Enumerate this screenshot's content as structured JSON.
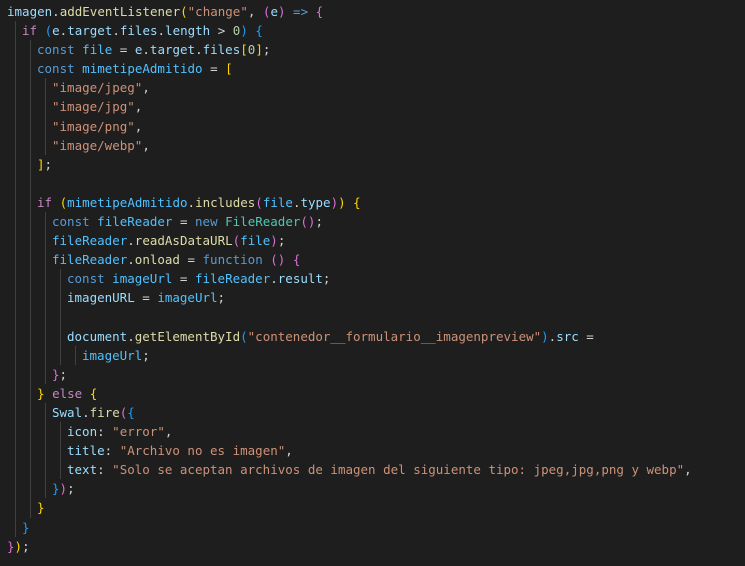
{
  "editor": {
    "lines": [
      [
        [
          "imagen",
          "var"
        ],
        [
          ".",
          "pun"
        ],
        [
          "addEventListener",
          "fn"
        ],
        [
          "(",
          "b1"
        ],
        [
          "\"change\"",
          "str"
        ],
        [
          ", ",
          "pun"
        ],
        [
          "(",
          "b2"
        ],
        [
          "e",
          "var"
        ],
        [
          ")",
          "b2"
        ],
        [
          " => ",
          "kw"
        ],
        [
          "{",
          "b2"
        ]
      ],
      [
        [
          "if",
          "ctl"
        ],
        [
          " ",
          "pun"
        ],
        [
          "(",
          "b3"
        ],
        [
          "e",
          "var"
        ],
        [
          ".",
          "pun"
        ],
        [
          "target",
          "var"
        ],
        [
          ".",
          "pun"
        ],
        [
          "files",
          "var"
        ],
        [
          ".",
          "pun"
        ],
        [
          "length",
          "var"
        ],
        [
          " > ",
          "pun"
        ],
        [
          "0",
          "num"
        ],
        [
          ")",
          "b3"
        ],
        [
          " ",
          "pun"
        ],
        [
          "{",
          "b3"
        ]
      ],
      [
        [
          "const",
          "kw"
        ],
        [
          " ",
          "pun"
        ],
        [
          "file",
          "cst"
        ],
        [
          " = ",
          "pun"
        ],
        [
          "e",
          "var"
        ],
        [
          ".",
          "pun"
        ],
        [
          "target",
          "var"
        ],
        [
          ".",
          "pun"
        ],
        [
          "files",
          "var"
        ],
        [
          "[",
          "b1"
        ],
        [
          "0",
          "num"
        ],
        [
          "]",
          "b1"
        ],
        [
          ";",
          "pun"
        ]
      ],
      [
        [
          "const",
          "kw"
        ],
        [
          " ",
          "pun"
        ],
        [
          "mimetipeAdmitido",
          "cst"
        ],
        [
          " = ",
          "pun"
        ],
        [
          "[",
          "b1"
        ]
      ],
      [
        [
          "\"image/jpeg\"",
          "str"
        ],
        [
          ",",
          "pun"
        ]
      ],
      [
        [
          "\"image/jpg\"",
          "str"
        ],
        [
          ",",
          "pun"
        ]
      ],
      [
        [
          "\"image/png\"",
          "str"
        ],
        [
          ",",
          "pun"
        ]
      ],
      [
        [
          "\"image/webp\"",
          "str"
        ],
        [
          ",",
          "pun"
        ]
      ],
      [
        [
          "]",
          "b1"
        ],
        [
          ";",
          "pun"
        ]
      ],
      [],
      [
        [
          "if",
          "ctl"
        ],
        [
          " ",
          "pun"
        ],
        [
          "(",
          "b1"
        ],
        [
          "mimetipeAdmitido",
          "cst"
        ],
        [
          ".",
          "pun"
        ],
        [
          "includes",
          "fn"
        ],
        [
          "(",
          "b2"
        ],
        [
          "file",
          "cst"
        ],
        [
          ".",
          "pun"
        ],
        [
          "type",
          "var"
        ],
        [
          ")",
          "b2"
        ],
        [
          ")",
          "b1"
        ],
        [
          " ",
          "pun"
        ],
        [
          "{",
          "b1"
        ]
      ],
      [
        [
          "const",
          "kw"
        ],
        [
          " ",
          "pun"
        ],
        [
          "fileReader",
          "cst"
        ],
        [
          " = ",
          "pun"
        ],
        [
          "new",
          "kw"
        ],
        [
          " ",
          "pun"
        ],
        [
          "FileReader",
          "cls"
        ],
        [
          "()",
          "b2"
        ],
        [
          ";",
          "pun"
        ]
      ],
      [
        [
          "fileReader",
          "cst"
        ],
        [
          ".",
          "pun"
        ],
        [
          "readAsDataURL",
          "fn"
        ],
        [
          "(",
          "b2"
        ],
        [
          "file",
          "cst"
        ],
        [
          ")",
          "b2"
        ],
        [
          ";",
          "pun"
        ]
      ],
      [
        [
          "fileReader",
          "cst"
        ],
        [
          ".",
          "pun"
        ],
        [
          "onload",
          "fn"
        ],
        [
          " = ",
          "pun"
        ],
        [
          "function",
          "kw"
        ],
        [
          " ",
          "pun"
        ],
        [
          "()",
          "b2"
        ],
        [
          " ",
          "pun"
        ],
        [
          "{",
          "b2"
        ]
      ],
      [
        [
          "const",
          "kw"
        ],
        [
          " ",
          "pun"
        ],
        [
          "imageUrl",
          "cst"
        ],
        [
          " = ",
          "pun"
        ],
        [
          "fileReader",
          "cst"
        ],
        [
          ".",
          "pun"
        ],
        [
          "result",
          "var"
        ],
        [
          ";",
          "pun"
        ]
      ],
      [
        [
          "imagenURL",
          "var"
        ],
        [
          " = ",
          "pun"
        ],
        [
          "imageUrl",
          "cst"
        ],
        [
          ";",
          "pun"
        ]
      ],
      [],
      [
        [
          "document",
          "var"
        ],
        [
          ".",
          "pun"
        ],
        [
          "getElementById",
          "fn"
        ],
        [
          "(",
          "b3"
        ],
        [
          "\"contenedor__formulario__imagenpreview\"",
          "str"
        ],
        [
          ")",
          "b3"
        ],
        [
          ".",
          "pun"
        ],
        [
          "src",
          "var"
        ],
        [
          " =",
          "pun"
        ]
      ],
      [
        [
          "imageUrl",
          "cst"
        ],
        [
          ";",
          "pun"
        ]
      ],
      [
        [
          "}",
          "b2"
        ],
        [
          ";",
          "pun"
        ]
      ],
      [
        [
          "}",
          "b1"
        ],
        [
          " ",
          "pun"
        ],
        [
          "else",
          "ctl"
        ],
        [
          " ",
          "pun"
        ],
        [
          "{",
          "b1"
        ]
      ],
      [
        [
          "Swal",
          "var"
        ],
        [
          ".",
          "pun"
        ],
        [
          "fire",
          "fn"
        ],
        [
          "(",
          "b2"
        ],
        [
          "{",
          "b3"
        ]
      ],
      [
        [
          "icon",
          "var"
        ],
        [
          ": ",
          "pun"
        ],
        [
          "\"error\"",
          "str"
        ],
        [
          ",",
          "pun"
        ]
      ],
      [
        [
          "title",
          "var"
        ],
        [
          ": ",
          "pun"
        ],
        [
          "\"Archivo no es imagen\"",
          "str"
        ],
        [
          ",",
          "pun"
        ]
      ],
      [
        [
          "text",
          "var"
        ],
        [
          ": ",
          "pun"
        ],
        [
          "\"Solo se aceptan archivos de imagen del siguiente tipo: jpeg,jpg,png y webp\"",
          "str"
        ],
        [
          ",",
          "pun"
        ]
      ],
      [
        [
          "}",
          "b3"
        ],
        [
          ")",
          "b2"
        ],
        [
          ";",
          "pun"
        ]
      ],
      [
        [
          "}",
          "b1"
        ]
      ],
      [
        [
          "}",
          "b3"
        ]
      ],
      [
        [
          "}",
          "b2"
        ],
        [
          ")",
          "b1"
        ],
        [
          ";",
          "pun"
        ]
      ]
    ]
  }
}
